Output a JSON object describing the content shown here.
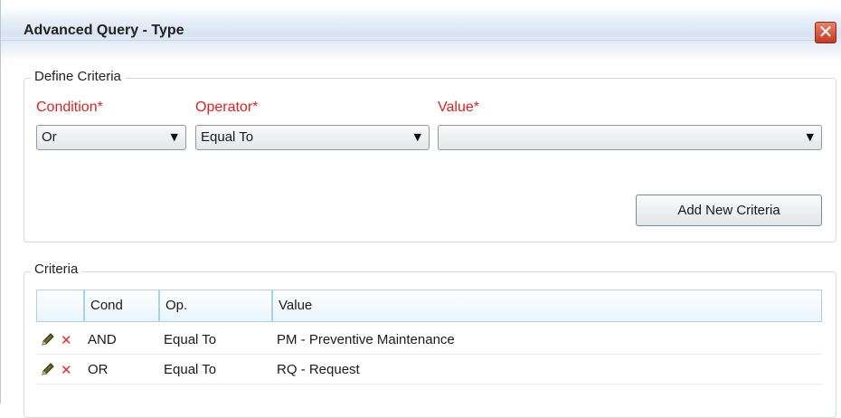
{
  "dialog": {
    "title": "Advanced Query - Type",
    "close_glyph": "✕"
  },
  "define_criteria": {
    "legend": "Define Criteria",
    "condition": {
      "label": "Condition*",
      "value": "Or"
    },
    "operator": {
      "label": "Operator*",
      "value": "Equal To"
    },
    "value": {
      "label": "Value*",
      "value": ""
    },
    "add_button": "Add New Criteria",
    "required_color": "#e02020"
  },
  "criteria": {
    "legend": "Criteria",
    "columns": [
      "",
      "Cond",
      "Op.",
      "Value"
    ],
    "rows": [
      {
        "cond": "AND",
        "op": "Equal To",
        "value": "PM - Preventive Maintenance"
      },
      {
        "cond": "OR",
        "op": "Equal To",
        "value": "RQ - Request"
      }
    ],
    "row_icons": [
      "pencil-edit-icon",
      "delete-x-icon"
    ]
  }
}
